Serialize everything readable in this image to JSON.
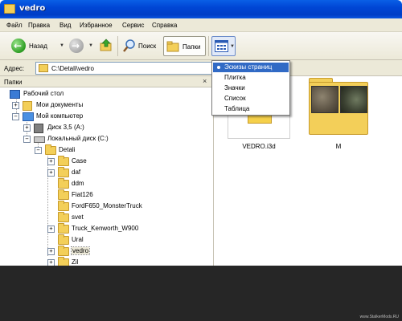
{
  "window": {
    "title": "vedro"
  },
  "menu": [
    "Файл",
    "Правка",
    "Вид",
    "Избранное",
    "Сервис",
    "Справка"
  ],
  "toolbar": {
    "back_label": "Назад",
    "search_label": "Поиск",
    "folders_label": "Папки"
  },
  "address": {
    "label": "Адрес:",
    "value": "C:\\Detali\\vedro"
  },
  "folders_pane": {
    "title": "Папки",
    "close_glyph": "×"
  },
  "tree": {
    "desktop": "Рабочий стол",
    "my_documents": "Мои документы",
    "my_computer": "Мой компьютер",
    "floppy": "Диск 3,5 (A:)",
    "local_disk": "Локальный диск (C:)",
    "detali": "Detali",
    "children": [
      "Case",
      "daf",
      "ddm",
      "Fiat126",
      "FordF650_MonsterTruck",
      "svet",
      "Truck_Kenworth_W900",
      "Ural",
      "vedro",
      "Zil"
    ]
  },
  "files": [
    {
      "name": "VEDRO.i3d",
      "icon": "document-icon"
    },
    {
      "name": "M",
      "icon": "folder-thumbnail"
    }
  ],
  "views_menu": {
    "options": [
      "Эскизы страниц",
      "Плитка",
      "Значки",
      "Список",
      "Таблица"
    ],
    "selected": "Эскизы страниц"
  },
  "watermark": "www.StalkerMods.RU"
}
